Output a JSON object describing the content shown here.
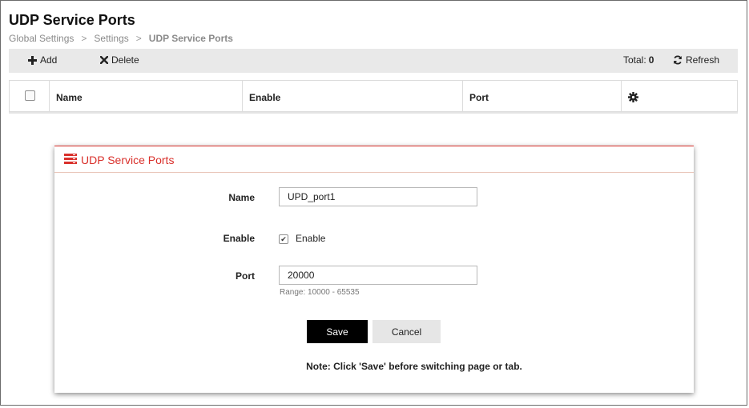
{
  "page": {
    "title": "UDP Service Ports",
    "breadcrumb": [
      "Global Settings",
      "Settings",
      "UDP Service Ports"
    ]
  },
  "toolbar": {
    "add_label": "Add",
    "delete_label": "Delete",
    "total_label": "Total:",
    "total_count": "0",
    "refresh_label": "Refresh"
  },
  "table": {
    "columns": [
      "Name",
      "Enable",
      "Port"
    ]
  },
  "dialog": {
    "title": "UDP Service Ports",
    "name_label": "Name",
    "name_value": "UPD_port1",
    "enable_label": "Enable",
    "enable_checked": true,
    "enable_text": "Enable",
    "port_label": "Port",
    "port_value": "20000",
    "range_hint": "Range: 10000 - 65535",
    "save_label": "Save",
    "cancel_label": "Cancel",
    "note": "Note: Click 'Save' before switching page or tab."
  },
  "colors": {
    "accent": "#d9302b",
    "toolbar_bg": "#e9e9e9",
    "save_bg": "#000000"
  },
  "icons": {
    "add": "plus-icon",
    "delete": "x-icon",
    "refresh": "refresh-icon",
    "settings": "gear-icon",
    "dialog": "server-icon"
  }
}
